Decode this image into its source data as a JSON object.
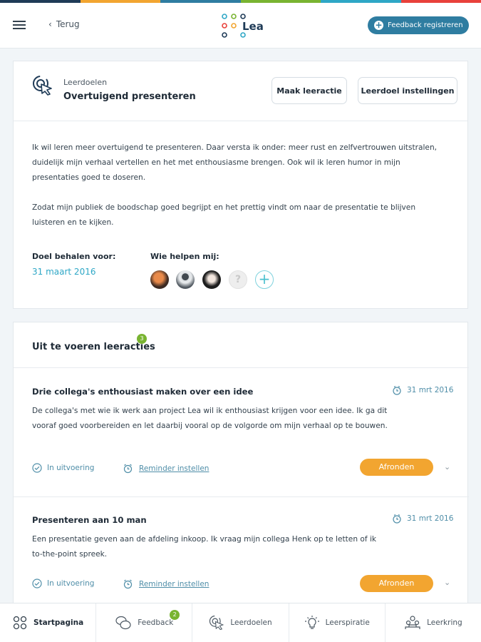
{
  "stripe_colors": [
    "#1f3b57",
    "#f2a530",
    "#2f7da1",
    "#79b431",
    "#2ea7c6",
    "#e8413b"
  ],
  "accent": "#2f7da1",
  "topbar": {
    "back_label": "Terug",
    "logo_text": "Lea",
    "feedback_button": "Feedback registreren"
  },
  "goal": {
    "section_label": "Leerdoelen",
    "title": "Overtuigend presenteren",
    "make_action_button": "Maak leeractie",
    "settings_button": "Leerdoel instellingen",
    "description_1": "Ik wil leren meer overtuigend  te presenteren. Daar versta ik onder: meer rust en zelfvertrouwen uitstralen, duidelijk mijn verhaal vertellen en het met enthousiasme brengen. Ook wil ik leren humor in mijn presentaties goed te doseren.",
    "description_2": "Zodat mijn publiek de boodschap goed begrijpt en het prettig vindt om naar de presentatie te blijven luisteren en te kijken.",
    "deadline_label": "Doel behalen voor:",
    "deadline_value": "31 maart 2016",
    "helpers_label": "Wie helpen mij:"
  },
  "actions": {
    "title": "Uit te voeren leeracties",
    "count": "3",
    "items": [
      {
        "title": "Drie collega's enthousiast maken over een idee",
        "date": "31 mrt 2016",
        "description": "De collega's met wie ik werk aan project Lea wil ik enthousiast krijgen voor een idee. Ik ga dit vooraf goed voorbereiden en let daarbij vooral op de volgorde om mijn verhaal op te bouwen.",
        "status": "In uitvoering",
        "reminder": "Reminder instellen",
        "complete_button": "Afronden"
      },
      {
        "title": "Presenteren aan 10 man",
        "date": "31 mrt 2016",
        "description": "Een presentatie geven aan de afdeling inkoop. Ik vraag mijn collega Henk op te letten of ik to-the-point spreek.",
        "status": "In uitvoering",
        "reminder": "Reminder instellen",
        "complete_button": "Afronden"
      }
    ]
  },
  "bottom_nav": {
    "items": [
      {
        "label": "Startpagina",
        "icon": "grid-icon"
      },
      {
        "label": "Feedback",
        "icon": "chat-bubbles-icon",
        "badge": "2"
      },
      {
        "label": "Leerdoelen",
        "icon": "target-cursor-icon"
      },
      {
        "label": "Leerspiratie",
        "icon": "lightbulb-icon"
      },
      {
        "label": "Leerkring",
        "icon": "people-group-icon"
      }
    ]
  }
}
